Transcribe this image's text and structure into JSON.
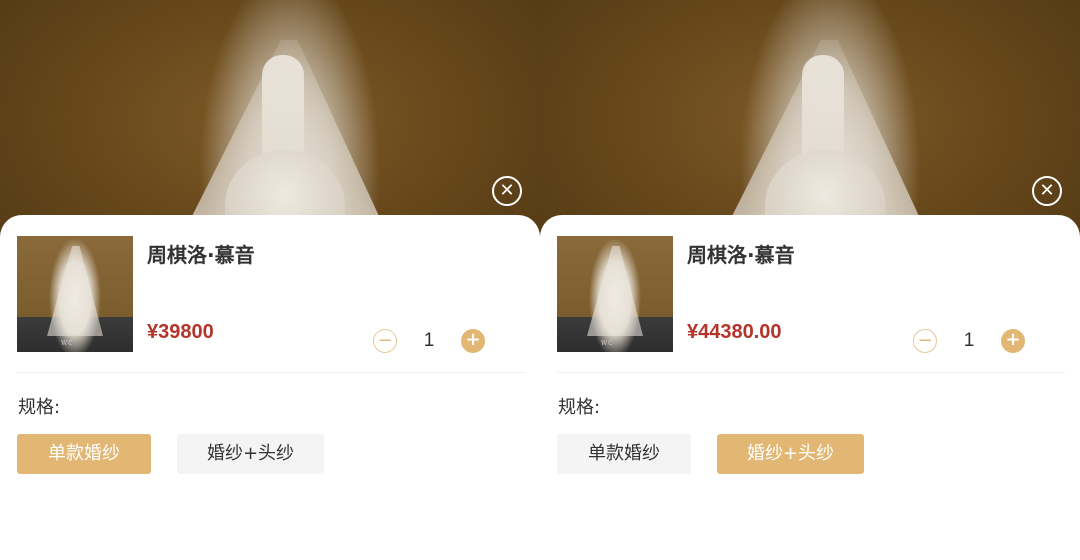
{
  "close_icon_glyph": "✕",
  "left": {
    "product": {
      "title": "周棋洛·慕音",
      "price": "¥39800",
      "thumb_logo": "WC"
    },
    "quantity": {
      "minus_glyph": "−",
      "value": "1",
      "plus_glyph": "+"
    },
    "spec": {
      "label": "规格:",
      "options": [
        {
          "label": "单款婚纱",
          "selected": true
        },
        {
          "label": "婚纱+头纱",
          "selected": false
        }
      ]
    }
  },
  "right": {
    "product": {
      "title": "周棋洛·慕音",
      "price": "¥44380.00",
      "thumb_logo": "WC"
    },
    "quantity": {
      "minus_glyph": "−",
      "value": "1",
      "plus_glyph": "+"
    },
    "spec": {
      "label": "规格:",
      "options": [
        {
          "label": "单款婚纱",
          "selected": false
        },
        {
          "label": "婚纱+头纱",
          "selected": true
        }
      ]
    }
  },
  "colors": {
    "accent": "#e2b774",
    "price": "#b5342a",
    "backdrop": "#6b4a1c"
  }
}
